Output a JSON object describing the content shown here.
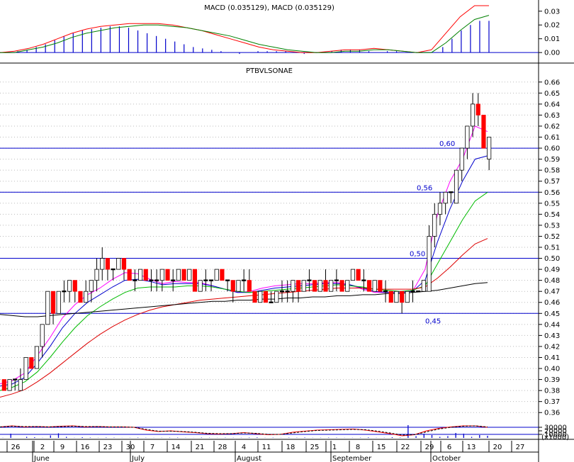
{
  "chart_data": [
    {
      "type": "line",
      "panel": "macd",
      "title": "MACD (0.035129), MACD (0.035129)",
      "yticks": [
        0.0,
        0.01,
        0.02,
        0.03
      ],
      "ytick_labels": [
        "0.00",
        "0.01",
        "0.02",
        "0.03"
      ],
      "ylim": [
        -0.003,
        0.034
      ],
      "series": [
        {
          "color": "#ff0000",
          "values": [
            0.0,
            0.001,
            0.003,
            0.006,
            0.01,
            0.014,
            0.017,
            0.019,
            0.02,
            0.021,
            0.021,
            0.021,
            0.02,
            0.018,
            0.016,
            0.013,
            0.01,
            0.007,
            0.004,
            0.002,
            0.001,
            0.0,
            0.0,
            0.001,
            0.002,
            0.002,
            0.003,
            0.002,
            0.001,
            0.0,
            0.002,
            0.014,
            0.026,
            0.034,
            0.034
          ]
        },
        {
          "color": "#008000",
          "values": [
            0.0,
            0.0,
            0.002,
            0.004,
            0.007,
            0.011,
            0.014,
            0.016,
            0.018,
            0.019,
            0.02,
            0.02,
            0.019,
            0.018,
            0.016,
            0.014,
            0.012,
            0.009,
            0.006,
            0.004,
            0.002,
            0.001,
            0.0,
            0.0,
            0.001,
            0.001,
            0.002,
            0.002,
            0.001,
            0.0,
            0.0,
            0.007,
            0.016,
            0.024,
            0.027
          ]
        }
      ],
      "hist": [
        0.0,
        0.001,
        0.002,
        0.004,
        0.006,
        0.009,
        0.012,
        0.014,
        0.016,
        0.017,
        0.018,
        0.019,
        0.019,
        0.018,
        0.016,
        0.014,
        0.012,
        0.01,
        0.008,
        0.006,
        0.004,
        0.003,
        0.002,
        0.001,
        0.0,
        -0.001,
        0.0,
        0.001,
        0.001,
        0.001,
        0.001,
        0.0,
        -0.001,
        0.0,
        0.0,
        0.001,
        0.002,
        0.002,
        0.002,
        0.001,
        0.0,
        0.001,
        0.001,
        0.0,
        0.0,
        0.0,
        0.0,
        0.004,
        0.01,
        0.016,
        0.02,
        0.023,
        0.023
      ]
    },
    {
      "type": "candlestick",
      "panel": "price",
      "title": "PTBVLSONAE",
      "ylim": [
        0.355,
        0.665
      ],
      "yticks": [
        0.36,
        0.37,
        0.38,
        0.39,
        0.4,
        0.41,
        0.42,
        0.43,
        0.44,
        0.45,
        0.46,
        0.47,
        0.48,
        0.49,
        0.5,
        0.51,
        0.52,
        0.53,
        0.54,
        0.55,
        0.56,
        0.57,
        0.58,
        0.59,
        0.6,
        0.61,
        0.62,
        0.63,
        0.64,
        0.65,
        0.66
      ],
      "ytick_labels": [
        "0.36",
        "0.37",
        "0.38",
        "0.39",
        "0.40",
        "0.41",
        "0.42",
        "0.43",
        "0.44",
        "0.45",
        "0.46",
        "0.47",
        "0.48",
        "0.49",
        "0.50",
        "0.51",
        "0.52",
        "0.53",
        "0.54",
        "0.55",
        "0.56",
        "0.57",
        "0.58",
        "0.59",
        "0.60",
        "0.61",
        "0.62",
        "0.63",
        "0.64",
        "0.65",
        "0.66"
      ],
      "x_ticks": [
        "26",
        "2",
        "9",
        "16",
        "23",
        "30",
        "7",
        "14",
        "21",
        "28",
        "4",
        "11",
        "18",
        "25",
        "1",
        "8",
        "15",
        "22",
        "29",
        "6",
        "13",
        "20",
        "27"
      ],
      "x_months": [
        "June",
        "July",
        "August",
        "September",
        "October"
      ],
      "hlines": [
        {
          "value": 0.6,
          "label": "0,60"
        },
        {
          "value": 0.56,
          "label": "0,56"
        },
        {
          "value": 0.5,
          "label": "0,50"
        },
        {
          "value": 0.45,
          "label": "0,45"
        }
      ],
      "candles": [
        [
          0.39,
          0.38,
          0.38,
          0.39
        ],
        [
          0.38,
          0.39,
          0.38,
          0.39
        ],
        [
          0.39,
          0.39,
          0.38,
          0.39
        ],
        [
          0.38,
          0.39,
          0.38,
          0.4
        ],
        [
          0.39,
          0.41,
          0.39,
          0.41
        ],
        [
          0.41,
          0.4,
          0.4,
          0.41
        ],
        [
          0.4,
          0.42,
          0.4,
          0.42
        ],
        [
          0.42,
          0.44,
          0.41,
          0.44
        ],
        [
          0.44,
          0.47,
          0.44,
          0.47
        ],
        [
          0.47,
          0.45,
          0.44,
          0.47
        ],
        [
          0.45,
          0.47,
          0.45,
          0.47
        ],
        [
          0.47,
          0.47,
          0.46,
          0.48
        ],
        [
          0.47,
          0.48,
          0.46,
          0.48
        ],
        [
          0.48,
          0.47,
          0.46,
          0.48
        ],
        [
          0.47,
          0.46,
          0.46,
          0.47
        ],
        [
          0.46,
          0.47,
          0.46,
          0.48
        ],
        [
          0.47,
          0.48,
          0.46,
          0.48
        ],
        [
          0.48,
          0.49,
          0.47,
          0.5
        ],
        [
          0.49,
          0.5,
          0.48,
          0.51
        ],
        [
          0.5,
          0.49,
          0.48,
          0.5
        ],
        [
          0.49,
          0.49,
          0.48,
          0.49
        ],
        [
          0.49,
          0.5,
          0.49,
          0.5
        ],
        [
          0.5,
          0.49,
          0.48,
          0.5
        ],
        [
          0.49,
          0.48,
          0.48,
          0.49
        ],
        [
          0.48,
          0.48,
          0.47,
          0.49
        ],
        [
          0.48,
          0.49,
          0.48,
          0.49
        ],
        [
          0.49,
          0.48,
          0.48,
          0.49
        ],
        [
          0.48,
          0.48,
          0.47,
          0.49
        ],
        [
          0.48,
          0.48,
          0.47,
          0.49
        ],
        [
          0.48,
          0.49,
          0.47,
          0.49
        ],
        [
          0.49,
          0.48,
          0.48,
          0.49
        ],
        [
          0.48,
          0.48,
          0.47,
          0.49
        ],
        [
          0.48,
          0.49,
          0.48,
          0.49
        ],
        [
          0.49,
          0.48,
          0.48,
          0.49
        ],
        [
          0.48,
          0.49,
          0.48,
          0.49
        ],
        [
          0.49,
          0.47,
          0.47,
          0.49
        ],
        [
          0.47,
          0.48,
          0.47,
          0.48
        ],
        [
          0.48,
          0.48,
          0.47,
          0.49
        ],
        [
          0.48,
          0.48,
          0.47,
          0.48
        ],
        [
          0.48,
          0.49,
          0.48,
          0.49
        ],
        [
          0.49,
          0.48,
          0.48,
          0.49
        ],
        [
          0.48,
          0.48,
          0.47,
          0.48
        ],
        [
          0.48,
          0.47,
          0.46,
          0.48
        ],
        [
          0.47,
          0.48,
          0.47,
          0.48
        ],
        [
          0.48,
          0.48,
          0.47,
          0.49
        ],
        [
          0.48,
          0.47,
          0.47,
          0.49
        ],
        [
          0.47,
          0.46,
          0.46,
          0.47
        ],
        [
          0.46,
          0.47,
          0.46,
          0.47
        ],
        [
          0.47,
          0.46,
          0.46,
          0.47
        ],
        [
          0.46,
          0.46,
          0.46,
          0.47
        ],
        [
          0.46,
          0.47,
          0.46,
          0.47
        ],
        [
          0.47,
          0.47,
          0.46,
          0.48
        ],
        [
          0.47,
          0.47,
          0.46,
          0.48
        ],
        [
          0.47,
          0.48,
          0.46,
          0.48
        ],
        [
          0.48,
          0.47,
          0.46,
          0.48
        ],
        [
          0.47,
          0.48,
          0.47,
          0.48
        ],
        [
          0.48,
          0.48,
          0.47,
          0.49
        ],
        [
          0.48,
          0.47,
          0.47,
          0.48
        ],
        [
          0.47,
          0.48,
          0.47,
          0.48
        ],
        [
          0.48,
          0.47,
          0.47,
          0.49
        ],
        [
          0.47,
          0.48,
          0.47,
          0.48
        ],
        [
          0.48,
          0.48,
          0.47,
          0.49
        ],
        [
          0.48,
          0.47,
          0.47,
          0.48
        ],
        [
          0.47,
          0.48,
          0.47,
          0.48
        ],
        [
          0.48,
          0.49,
          0.48,
          0.49
        ],
        [
          0.49,
          0.48,
          0.48,
          0.49
        ],
        [
          0.48,
          0.48,
          0.47,
          0.49
        ],
        [
          0.48,
          0.47,
          0.47,
          0.48
        ],
        [
          0.47,
          0.48,
          0.47,
          0.48
        ],
        [
          0.48,
          0.47,
          0.47,
          0.48
        ],
        [
          0.47,
          0.47,
          0.46,
          0.48
        ],
        [
          0.47,
          0.46,
          0.46,
          0.47
        ],
        [
          0.46,
          0.47,
          0.46,
          0.47
        ],
        [
          0.47,
          0.46,
          0.45,
          0.47
        ],
        [
          0.46,
          0.47,
          0.46,
          0.47
        ],
        [
          0.47,
          0.47,
          0.46,
          0.48
        ],
        [
          0.47,
          0.47,
          0.47,
          0.47
        ],
        [
          0.47,
          0.48,
          0.47,
          0.48
        ],
        [
          0.47,
          0.52,
          0.47,
          0.53
        ],
        [
          0.52,
          0.54,
          0.51,
          0.55
        ],
        [
          0.54,
          0.55,
          0.53,
          0.56
        ],
        [
          0.55,
          0.56,
          0.54,
          0.56
        ],
        [
          0.56,
          0.56,
          0.55,
          0.56
        ],
        [
          0.55,
          0.58,
          0.55,
          0.58
        ],
        [
          0.58,
          0.6,
          0.57,
          0.6
        ],
        [
          0.6,
          0.62,
          0.59,
          0.62
        ],
        [
          0.62,
          0.64,
          0.61,
          0.65
        ],
        [
          0.64,
          0.63,
          0.62,
          0.65
        ],
        [
          0.63,
          0.6,
          0.6,
          0.63
        ],
        [
          0.59,
          0.61,
          0.58,
          0.61
        ]
      ],
      "ma_series": [
        {
          "color": "#ff00ff",
          "values": [
            0.386,
            0.389,
            0.396,
            0.412,
            0.428,
            0.446,
            0.458,
            0.467,
            0.473,
            0.481,
            0.487,
            0.486,
            0.481,
            0.477,
            0.479,
            0.478,
            0.478,
            0.475,
            0.472,
            0.469,
            0.47,
            0.473,
            0.475,
            0.476,
            0.477,
            0.477,
            0.478,
            0.478,
            0.476,
            0.472,
            0.469,
            0.469,
            0.47,
            0.47,
            0.49,
            0.54,
            0.57,
            0.59,
            0.62,
            0.615
          ]
        },
        {
          "color": "#0000cc",
          "values": [
            0.384,
            0.386,
            0.392,
            0.405,
            0.42,
            0.437,
            0.45,
            0.46,
            0.467,
            0.474,
            0.48,
            0.481,
            0.479,
            0.476,
            0.477,
            0.477,
            0.477,
            0.475,
            0.472,
            0.469,
            0.469,
            0.471,
            0.473,
            0.474,
            0.475,
            0.476,
            0.477,
            0.477,
            0.476,
            0.473,
            0.47,
            0.469,
            0.469,
            0.47,
            0.48,
            0.515,
            0.545,
            0.57,
            0.59,
            0.593
          ]
        },
        {
          "color": "#00bb00",
          "values": [
            0.38,
            0.383,
            0.388,
            0.397,
            0.41,
            0.424,
            0.437,
            0.448,
            0.456,
            0.463,
            0.469,
            0.473,
            0.474,
            0.474,
            0.474,
            0.475,
            0.475,
            0.474,
            0.472,
            0.47,
            0.469,
            0.47,
            0.471,
            0.472,
            0.473,
            0.474,
            0.475,
            0.476,
            0.475,
            0.474,
            0.472,
            0.471,
            0.47,
            0.471,
            0.475,
            0.495,
            0.515,
            0.535,
            0.552,
            0.56
          ]
        },
        {
          "color": "#dd0000",
          "values": [
            0.374,
            0.377,
            0.381,
            0.388,
            0.396,
            0.405,
            0.414,
            0.423,
            0.431,
            0.438,
            0.444,
            0.449,
            0.453,
            0.456,
            0.458,
            0.46,
            0.462,
            0.463,
            0.464,
            0.465,
            0.466,
            0.467,
            0.468,
            0.469,
            0.47,
            0.471,
            0.472,
            0.473,
            0.473,
            0.473,
            0.472,
            0.472,
            0.472,
            0.472,
            0.474,
            0.482,
            0.492,
            0.503,
            0.513,
            0.518
          ]
        },
        {
          "color": "#000000",
          "values": [
            0.449,
            0.448,
            0.447,
            0.447,
            0.448,
            0.449,
            0.45,
            0.451,
            0.452,
            0.453,
            0.454,
            0.455,
            0.456,
            0.457,
            0.458,
            0.459,
            0.46,
            0.461,
            0.461,
            0.462,
            0.462,
            0.463,
            0.463,
            0.464,
            0.464,
            0.465,
            0.465,
            0.466,
            0.466,
            0.467,
            0.467,
            0.468,
            0.468,
            0.469,
            0.47,
            0.471,
            0.473,
            0.475,
            0.477,
            0.478
          ]
        }
      ]
    },
    {
      "type": "line",
      "panel": "volume",
      "yticks": [
        10000,
        20000,
        30000
      ],
      "ytick_labels": [
        "10000",
        "20000",
        "30000"
      ],
      "unit_label": "(x1000)",
      "ylim": [
        0,
        36000
      ],
      "hlines": [
        10000,
        30000
      ],
      "oscillator": [
        {
          "color": "#ff0000",
          "dash": false,
          "values": [
            31000,
            34000,
            31000,
            32000,
            31000,
            33000,
            34000,
            31000,
            32000,
            31000,
            31000,
            30000,
            22000,
            18000,
            20000,
            17000,
            15000,
            12000,
            11000,
            12000,
            15000,
            12000,
            9000,
            10000,
            16000,
            19000,
            22000,
            23000,
            24000,
            25000,
            22000,
            17000,
            12000,
            6000,
            9000,
            20000,
            27000,
            31000,
            34000,
            34000,
            30000
          ]
        },
        {
          "color": "#000000",
          "dash": true,
          "values": [
            31000,
            33000,
            32000,
            32000,
            31000,
            32000,
            33000,
            32000,
            32000,
            31000,
            31000,
            30000,
            24000,
            19000,
            19000,
            18000,
            16000,
            13000,
            12000,
            12000,
            14000,
            13000,
            10000,
            10000,
            14000,
            18000,
            21000,
            22000,
            23000,
            24000,
            23000,
            19000,
            14000,
            8000,
            9000,
            17000,
            25000,
            30000,
            33000,
            34000,
            31000
          ]
        }
      ],
      "volume": [
        500,
        12000,
        0,
        3000,
        2000,
        500,
        7000,
        13000,
        3000,
        500,
        2000,
        1000,
        500,
        1000,
        800,
        300,
        500,
        1000,
        600,
        400,
        500,
        800,
        1000,
        500,
        300,
        1000,
        700,
        400,
        800,
        600,
        500,
        1000,
        1500,
        500,
        800,
        400,
        900,
        700,
        1200,
        500,
        600,
        1000,
        800,
        400,
        500,
        700,
        1400,
        500,
        600,
        2000,
        1000,
        36000,
        5000,
        12000,
        8000,
        3000,
        5000,
        14000,
        12000,
        3000,
        8000,
        6000
      ]
    }
  ]
}
